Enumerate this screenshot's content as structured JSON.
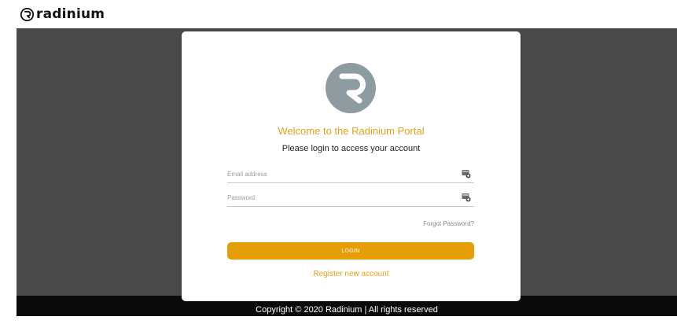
{
  "brand": {
    "name": "radinium"
  },
  "login_card": {
    "welcome": "Welcome to the Radinium Portal",
    "subtitle": "Please login to access your account",
    "email_placeholder": "Email address",
    "password_placeholder": "Password",
    "forgot_password": "Forgot Password?",
    "login_label": "LOGIN",
    "register_label": "Register new account"
  },
  "footer": {
    "copyright": "Copyright © 2020 Radinium | All rights reserved"
  },
  "colors": {
    "accent": "#e59e05",
    "accent_text": "#e4a21a",
    "backdrop": "#4a4a4a",
    "footer": "#0a0a0a",
    "logo": "#8e9ba0"
  },
  "icons": {
    "brand": "radinium-logo-icon",
    "card_logo": "radinium-logo-icon",
    "email_field": "autofill-icon",
    "password_field": "autofill-icon"
  }
}
